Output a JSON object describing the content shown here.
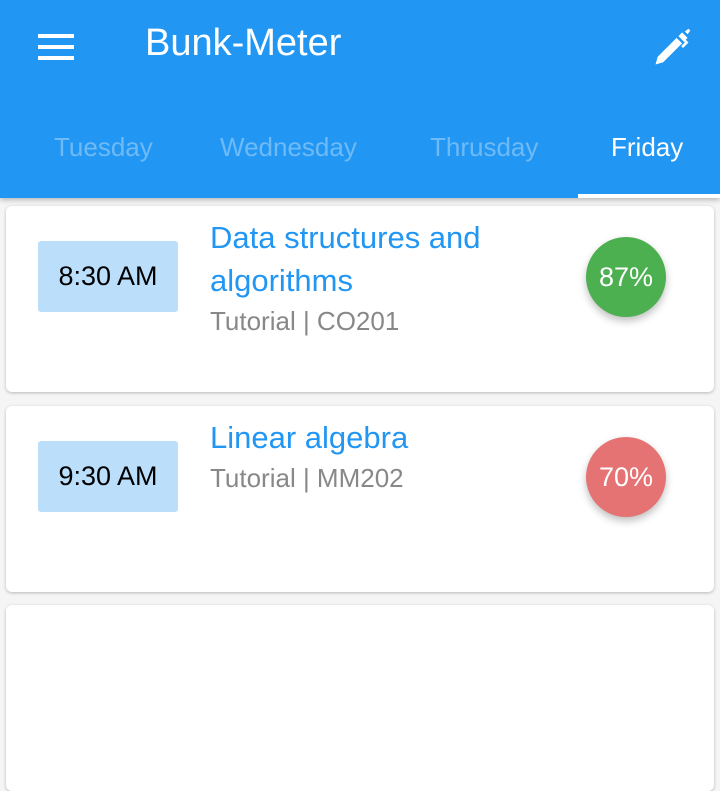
{
  "app": {
    "title": "Bunk-Meter",
    "menu_icon": "menu-icon",
    "edit_icon": "pen-icon"
  },
  "tabs": [
    {
      "label": "Tuesday",
      "active": false
    },
    {
      "label": "Wednesday",
      "active": false
    },
    {
      "label": "Thrusday",
      "active": false
    },
    {
      "label": "Friday",
      "active": true
    }
  ],
  "classes": [
    {
      "time": "8:30 AM",
      "subject": "Data structures and algorithms",
      "meta": "Tutorial | CO201",
      "attendance": "87%",
      "color": "#4CAF50"
    },
    {
      "time": "9:30 AM",
      "subject": "Linear algebra",
      "meta": "Tutorial | MM202",
      "attendance": "70%",
      "color": "#E57373"
    }
  ],
  "colors": {
    "primary": "#2196F3",
    "time_bg": "#BBDEFB"
  }
}
